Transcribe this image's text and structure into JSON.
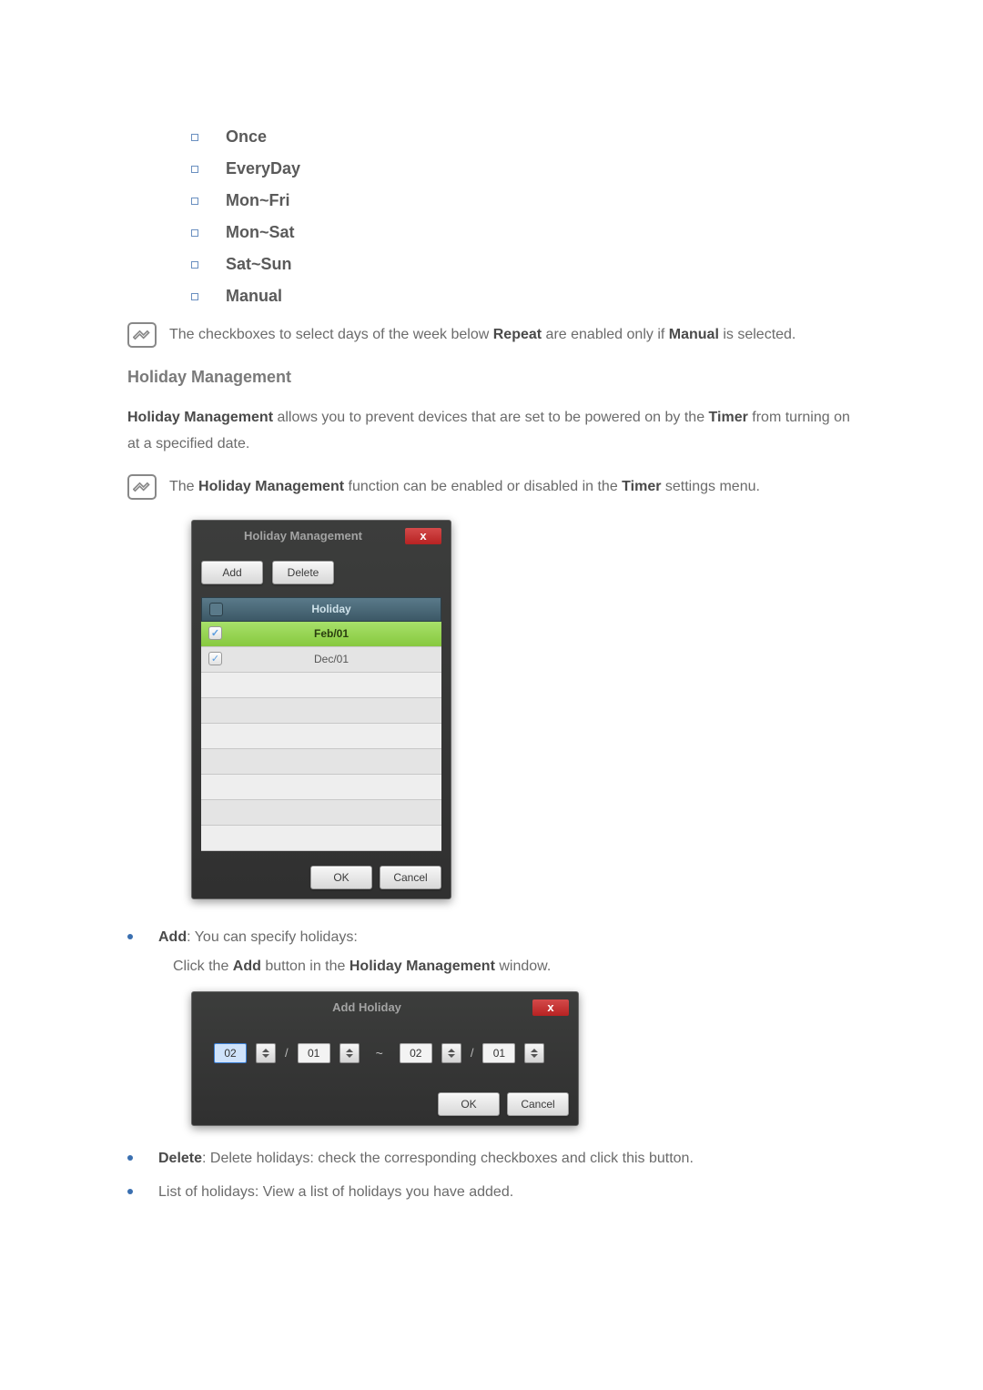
{
  "repeat_options": [
    "Once",
    "EveryDay",
    "Mon~Fri",
    "Mon~Sat",
    "Sat~Sun",
    "Manual"
  ],
  "note1_prefix": "The checkboxes to select days of the week below ",
  "note1_b1": "Repeat",
  "note1_mid": " are enabled only if ",
  "note1_b2": "Manual",
  "note1_suffix": " is selected.",
  "holiday_mgmt_heading": "Holiday Management",
  "hm_body_b1": "Holiday Management",
  "hm_body_mid": " allows you to prevent devices that are set to be powered on by the ",
  "hm_body_b2": "Timer",
  "hm_body_suffix": " from turning on at a specified date.",
  "note2_prefix": "The ",
  "note2_b1": "Holiday Management",
  "note2_mid": " function can be enabled or disabled in the ",
  "note2_b2": "Timer",
  "note2_suffix": " settings menu.",
  "holiday_dialog": {
    "title": "Holiday Management",
    "close": "x",
    "add_btn": "Add",
    "delete_btn": "Delete",
    "col_header": "Holiday",
    "rows": [
      "Feb/01",
      "Dec/01"
    ],
    "ok": "OK",
    "cancel": "Cancel"
  },
  "add_bullet_b": "Add",
  "add_bullet_text": ": You can specify holidays:",
  "add_sub_prefix": "Click the ",
  "add_sub_b1": "Add",
  "add_sub_mid": " button in the ",
  "add_sub_b2": "Holiday Management",
  "add_sub_suffix": " window.",
  "add_dialog": {
    "title": "Add Holiday",
    "close": "x",
    "month1": "02",
    "day1": "01",
    "month2": "02",
    "day2": "01",
    "slash": "/",
    "tilde": "~",
    "ok": "OK",
    "cancel": "Cancel"
  },
  "delete_bullet_b": "Delete",
  "delete_bullet_text": ": Delete holidays: check the corresponding checkboxes and click this button.",
  "list_bullet_text": "List of holidays: View a list of holidays you have added."
}
